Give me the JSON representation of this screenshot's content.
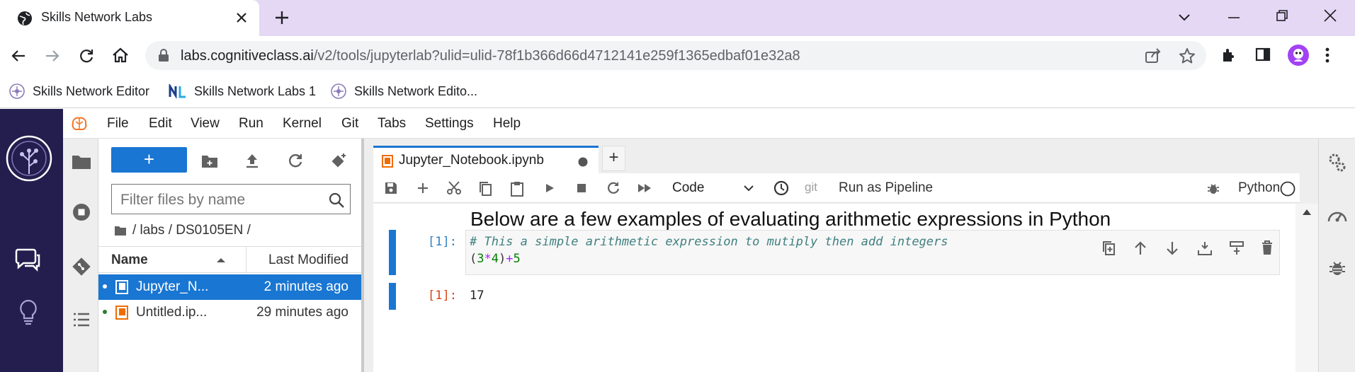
{
  "browser": {
    "tab_title": "Skills Network Labs",
    "url_domain": "labs.cognitiveclass.ai",
    "url_path": "/v2/tools/jupyterlab?ulid=ulid-78f1b366d66d4712141e259f1365edbaf01e32a8",
    "bookmarks": [
      {
        "label": "Skills Network Editor"
      },
      {
        "label": "Skills Network Labs 1"
      },
      {
        "label": "Skills Network Edito..."
      }
    ],
    "profile_color": "#a142f4",
    "tabstrip_color": "#e5d8f5"
  },
  "menubar": {
    "items": [
      "File",
      "Edit",
      "View",
      "Run",
      "Kernel",
      "Git",
      "Tabs",
      "Settings",
      "Help"
    ]
  },
  "filebrowser": {
    "new_button_label": "+",
    "filter_placeholder": "Filter files by name",
    "breadcrumb": "/ labs / DS0105EN /",
    "col_name": "Name",
    "col_modified": "Last Modified",
    "files": [
      {
        "name": "Jupyter_N...",
        "modified": "2 minutes ago",
        "selected": true
      },
      {
        "name": "Untitled.ip...",
        "modified": "29 minutes ago",
        "selected": false
      }
    ]
  },
  "notebook": {
    "tab_title": "Jupyter_Notebook.ipynb",
    "add_tab": "+",
    "cell_type": "Code",
    "git_label": "git",
    "pipeline_label": "Run as Pipeline",
    "kernel_name": "Python",
    "heading": "Below are a few examples of evaluating arithmetic expressions in Python",
    "input_prompt": "[1]:",
    "code_comment": "# This a simple arithmetic expression to mutiply then add integers",
    "code_line2": {
      "p1": "(",
      "n1": "3",
      "op1": "*",
      "n2": "4",
      "p2": ")",
      "op2": "+",
      "n3": "5"
    },
    "output_prompt": "[1]:",
    "output_value": "17"
  },
  "colors": {
    "accent": "#1976d2",
    "leftbar": "#231e4d",
    "comment": "#408080",
    "number": "#008000",
    "operator": "#aa22ff",
    "out_prompt": "#d84315",
    "in_prompt": "#307fc1"
  }
}
